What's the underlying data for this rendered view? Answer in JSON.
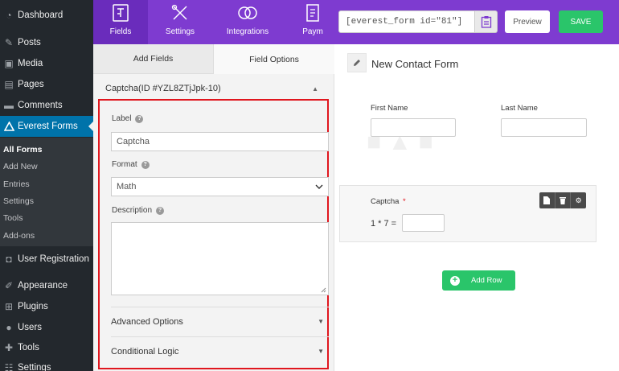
{
  "sidebar": {
    "items": [
      {
        "label": "Dashboard",
        "icon": "dashboard-icon"
      },
      {
        "label": "Posts",
        "icon": "pin-icon"
      },
      {
        "label": "Media",
        "icon": "media-icon"
      },
      {
        "label": "Pages",
        "icon": "page-icon"
      },
      {
        "label": "Comments",
        "icon": "comment-icon"
      },
      {
        "label": "Everest Forms",
        "icon": "everest-forms-icon"
      }
    ],
    "submenu": [
      "All Forms",
      "Add New",
      "Entries",
      "Settings",
      "Tools",
      "Add-ons"
    ],
    "items_bottom": [
      {
        "label": "User Registration",
        "icon": "user-registration-icon"
      },
      {
        "label": "Appearance",
        "icon": "brush-icon"
      },
      {
        "label": "Plugins",
        "icon": "plugin-icon"
      },
      {
        "label": "Users",
        "icon": "users-icon"
      },
      {
        "label": "Tools",
        "icon": "wrench-icon"
      },
      {
        "label": "Settings",
        "icon": "settings-icon"
      }
    ]
  },
  "topbar": {
    "tabs": [
      {
        "label": "Fields",
        "icon": "fields-icon"
      },
      {
        "label": "Settings",
        "icon": "settings-tools-icon"
      },
      {
        "label": "Integrations",
        "icon": "integrations-icon"
      },
      {
        "label": "Paym",
        "icon": "payment-icon"
      }
    ],
    "shortcode": "[everest_form id=\"81\"]",
    "preview_label": "Preview",
    "save_label": "SAVE",
    "accent": "#7e3bd0"
  },
  "panel": {
    "tab_add_fields": "Add Fields",
    "tab_field_options": "Field Options",
    "section_title": "Captcha(ID #YZL8ZTjJpk-10)",
    "label_label": "Label",
    "label_value": "Captcha",
    "format_label": "Format",
    "format_value": "Math",
    "description_label": "Description",
    "advanced_options": "Advanced Options",
    "conditional_logic": "Conditional Logic"
  },
  "canvas": {
    "form_title": "New Contact Form",
    "first_name": "First Name",
    "last_name": "Last Name",
    "captcha_label": "Captcha",
    "required_mark": "*",
    "captcha_question": "1 * 7 =",
    "add_row": "Add Row"
  }
}
